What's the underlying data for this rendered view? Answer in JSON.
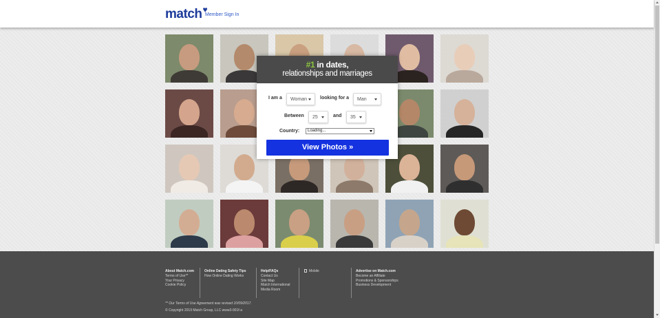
{
  "header": {
    "logo_text": "match",
    "logo_heart": "♥",
    "signin_label": "Member Sign In"
  },
  "photos": [
    {
      "skin": "#c79b7f",
      "bg": "#7d8a6b",
      "cloth": "#3e3a35"
    },
    {
      "skin": "#b48a6c",
      "bg": "#c8c6bd",
      "cloth": "#3a3838"
    },
    {
      "skin": "#c9a080",
      "bg": "#d9c7a8",
      "cloth": "#8d6d4a"
    },
    {
      "skin": "#d8b9a3",
      "bg": "#dcdcdc",
      "cloth": "#505050"
    },
    {
      "skin": "#e0bda2",
      "bg": "#6f5a6d",
      "cloth": "#2b2320"
    },
    {
      "skin": "#e8cdb9",
      "bg": "#ddd9d3",
      "cloth": "#b9a99c"
    },
    {
      "skin": "#d4a58c",
      "bg": "#6b4a46",
      "cloth": "#3b2624"
    },
    {
      "skin": "#d7ab8f",
      "bg": "#b99d8e",
      "cloth": "#6e4b3b"
    },
    {
      "skin": "#caa08a",
      "bg": "#d7d1ca",
      "cloth": "#3a3a3a"
    },
    {
      "skin": "#cda58a",
      "bg": "#e0dad4",
      "cloth": "#cc3a3a"
    },
    {
      "skin": "#b48768",
      "bg": "#7b8a6c",
      "cloth": "#3f4540"
    },
    {
      "skin": "#d6b29a",
      "bg": "#d0d0d0",
      "cloth": "#262626"
    },
    {
      "skin": "#e6c9b4",
      "bg": "#cfc7bf",
      "cloth": "#f1ebe6"
    },
    {
      "skin": "#d2ab8f",
      "bg": "#dedbd6",
      "cloth": "#f4f4f4"
    },
    {
      "skin": "#c69a7b",
      "bg": "#7a6f64",
      "cloth": "#2d2725"
    },
    {
      "skin": "#d2b19c",
      "bg": "#cfc5b8",
      "cloth": "#8d7a6b"
    },
    {
      "skin": "#dbb397",
      "bg": "#4d4f3a",
      "cloth": "#f1f1f1"
    },
    {
      "skin": "#c69979",
      "bg": "#5e5a57",
      "cloth": "#2f2f2f"
    },
    {
      "skin": "#d3ad93",
      "bg": "#c1ccc1",
      "cloth": "#2d3a4a"
    },
    {
      "skin": "#bb8a6e",
      "bg": "#6b3a3a",
      "cloth": "#dda0a0"
    },
    {
      "skin": "#c9a083",
      "bg": "#7b8b70",
      "cloth": "#d9cf4a"
    },
    {
      "skin": "#c99f84",
      "bg": "#b9b6ae",
      "cloth": "#3a3a3a"
    },
    {
      "skin": "#c5a68c",
      "bg": "#8fa3b5",
      "cloth": "#d8d1c8"
    },
    {
      "skin": "#6e4a34",
      "bg": "#dfe0d3",
      "cloth": "#e6e4b8"
    }
  ],
  "signup": {
    "headline_number": "#1",
    "headline_rest": " in dates,",
    "headline_line2": "relationships and marriages",
    "i_am_label": "I am a",
    "i_am_value": "Woman",
    "looking_label": "looking for a",
    "looking_value": "Man",
    "between_label": "Between",
    "age_min": "25",
    "and_label": "and",
    "age_max": "35",
    "country_label": "Country:",
    "country_value": "Loading...",
    "button_label": "View Photos »"
  },
  "footer": {
    "col1": {
      "heading": "About Match.com",
      "links": [
        "Terms of Use**",
        "Your Privacy",
        "Cookie Policy"
      ]
    },
    "col2": {
      "heading": "Online Dating Safety Tips",
      "links": [
        "How Online Dating Works"
      ]
    },
    "col3": {
      "heading": "Help/FAQs",
      "links": [
        "Contact Us",
        "Site Map",
        "Match International",
        "Media Room"
      ]
    },
    "col4": {
      "mobile_label": "Mobile"
    },
    "col5": {
      "heading": "Advertise on Match.com",
      "links": [
        "Become an Affiliate",
        "Promotions & Sponsorships",
        "Business Development"
      ]
    },
    "terms_note": "** Our Terms of Use Agreement was revised 10/09/2017.",
    "copyright": "© Copyright 2019 Match Group, LLC www3-001f-a"
  },
  "colors": {
    "brand_blue": "#1d3b9a",
    "button_blue": "#1432e0",
    "headline_green": "#8cc63f",
    "footer_bg": "#4c4c4c"
  }
}
